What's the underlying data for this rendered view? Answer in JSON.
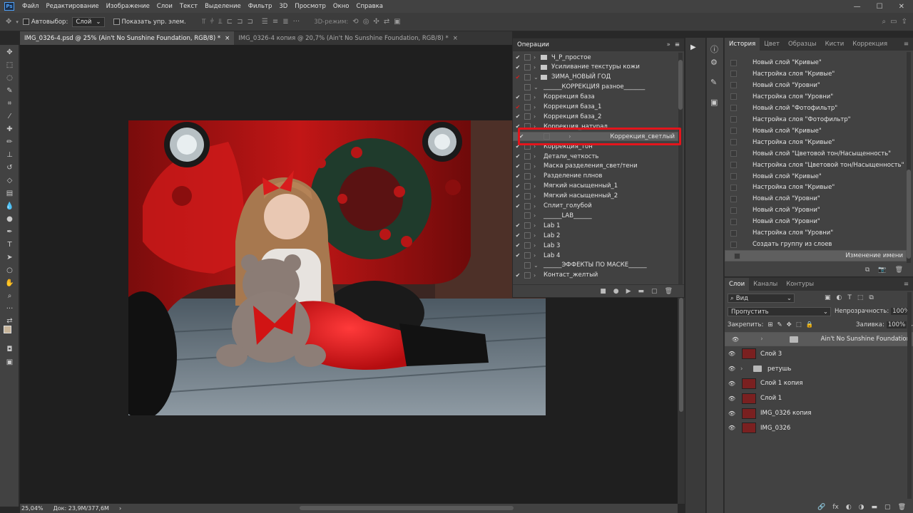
{
  "app": {
    "logo": "Ps"
  },
  "menu": [
    "Файл",
    "Редактирование",
    "Изображение",
    "Слои",
    "Текст",
    "Выделение",
    "Фильтр",
    "3D",
    "Просмотр",
    "Окно",
    "Справка"
  ],
  "window_controls": {
    "min": "—",
    "max": "☐",
    "close": "✕"
  },
  "options": {
    "autoselect_label": "Автовыбор:",
    "autoselect_value": "Слой",
    "show_controls_label": "Показать упр. элем.",
    "mode3d_label": "3D-режим:"
  },
  "tabs": [
    {
      "label": "IMG_0326-4.psd @ 25% (Ain't No Sunshine Foundation, RGB/8) *",
      "close": "×"
    },
    {
      "label": "IMG_0326-4 копия @ 20,7% (Ain't No Sunshine Foundation, RGB/8) *",
      "close": "×"
    }
  ],
  "status": {
    "zoom": "25,04%",
    "doc": "Док: 23,9M/377,6M",
    "arrow": "›"
  },
  "actions_panel": {
    "title": "Операции",
    "collapse": "»",
    "menu": "≡",
    "rows": [
      {
        "check": "✔",
        "dialog": true,
        "expander": "›",
        "label": "Ч_Р_простое",
        "folder": true
      },
      {
        "check": "✔",
        "dialog": true,
        "expander": "›",
        "label": "Усиливание текстуры кожи",
        "folder": true
      },
      {
        "check": "✔",
        "dialog": true,
        "expander": "⌄",
        "label": "ЗИМА_НОВЫЙ ГОД",
        "folder": true,
        "check_red": true
      },
      {
        "check": "",
        "dialog": false,
        "expander": "⌄",
        "label": "______КОРРЕКЦИЯ разное_______"
      },
      {
        "check": "✔",
        "dialog": false,
        "expander": "›",
        "label": "Коррекция база"
      },
      {
        "check": "✔",
        "dialog": false,
        "expander": "›",
        "label": "Коррекция база_1",
        "check_red": true
      },
      {
        "check": "✔",
        "dialog": false,
        "expander": "›",
        "label": "Коррекция база_2"
      },
      {
        "check": "✔",
        "dialog": false,
        "expander": "›",
        "label": "Коррекция_натурал"
      },
      {
        "check": "✔",
        "dialog": false,
        "expander": "›",
        "label": "Коррекция_светлый",
        "selected": true
      },
      {
        "check": "✔",
        "dialog": false,
        "expander": "›",
        "label": "Коррекция_тон"
      },
      {
        "check": "✔",
        "dialog": false,
        "expander": "›",
        "label": "Детали_четкость"
      },
      {
        "check": "✔",
        "dialog": false,
        "expander": "›",
        "label": "Маска разделения_свет/тени"
      },
      {
        "check": "✔",
        "dialog": false,
        "expander": "›",
        "label": "Разделение плнов"
      },
      {
        "check": "✔",
        "dialog": false,
        "expander": "›",
        "label": "Мягкий насыщенный_1"
      },
      {
        "check": "✔",
        "dialog": false,
        "expander": "›",
        "label": "Мягкий насыщенный_2"
      },
      {
        "check": "✔",
        "dialog": false,
        "expander": "›",
        "label": "Сплит_голубой"
      },
      {
        "check": "",
        "dialog": false,
        "expander": "›",
        "label": "______LAB______"
      },
      {
        "check": "✔",
        "dialog": false,
        "expander": "›",
        "label": "Lab 1"
      },
      {
        "check": "✔",
        "dialog": false,
        "expander": "›",
        "label": "Lab 2"
      },
      {
        "check": "✔",
        "dialog": false,
        "expander": "›",
        "label": "Lab 3"
      },
      {
        "check": "✔",
        "dialog": false,
        "expander": "›",
        "label": "Lab 4"
      },
      {
        "check": "",
        "dialog": false,
        "expander": "⌄",
        "label": "______ЭФФЕКТЫ ПО МАСКЕ______"
      },
      {
        "check": "✔",
        "dialog": true,
        "expander": "›",
        "label": "Контаст_желтый"
      }
    ],
    "bottom_icons": [
      "■",
      "●",
      "▶",
      "▬",
      "▢",
      "🗑"
    ]
  },
  "history_panel": {
    "tabs": [
      "История",
      "Цвет",
      "Образцы",
      "Кисти",
      "Коррекция"
    ],
    "menu": "≡",
    "rows": [
      "Новый слой \"Кривые\"",
      "Настройка слоя \"Кривые\"",
      "Новый слой \"Уровни\"",
      "Настройка слоя \"Уровни\"",
      "Новый слой \"Фотофильтр\"",
      "Настройка слоя \"Фотофильтр\"",
      "Новый слой \"Кривые\"",
      "Настройка слоя \"Кривые\"",
      "Новый слой \"Цветовой тон/Насыщенность\"",
      "Настройка слоя \"Цветовой тон/Насыщенность\"",
      "Новый слой \"Кривые\"",
      "Настройка слоя \"Кривые\"",
      "Новый слой \"Уровни\"",
      "Новый слой \"Уровни\"",
      "Новый слой \"Уровни\"",
      "Настройка слоя \"Уровни\"",
      "Создать группу из слоев",
      "Изменение имени"
    ],
    "selected_index": 17,
    "bottom_icons": [
      "⧉",
      "📷",
      "🗑"
    ]
  },
  "layers_panel": {
    "tabs": [
      "Слои",
      "Каналы",
      "Контуры"
    ],
    "menu": "≡",
    "filter_label": "Вид",
    "blend_mode": "Пропустить",
    "opacity_label": "Непрозрачность:",
    "opacity_value": "100%",
    "lock_label": "Закрепить:",
    "fill_label": "Заливка:",
    "fill_value": "100%",
    "layers": [
      {
        "name": "Ain't No Sunshine Foundation",
        "type": "group",
        "selected": true
      },
      {
        "name": "Слой 3",
        "type": "pixel"
      },
      {
        "name": "ретушь",
        "type": "group"
      },
      {
        "name": "Слой 1 копия",
        "type": "pixel"
      },
      {
        "name": "Слой 1",
        "type": "pixel"
      },
      {
        "name": "IMG_0326 копия",
        "type": "pixel"
      },
      {
        "name": "IMG_0326",
        "type": "pixel"
      }
    ],
    "bottom_icons": [
      "🔗",
      "fx",
      "◐",
      "◑",
      "▬",
      "▢",
      "🗑"
    ]
  }
}
